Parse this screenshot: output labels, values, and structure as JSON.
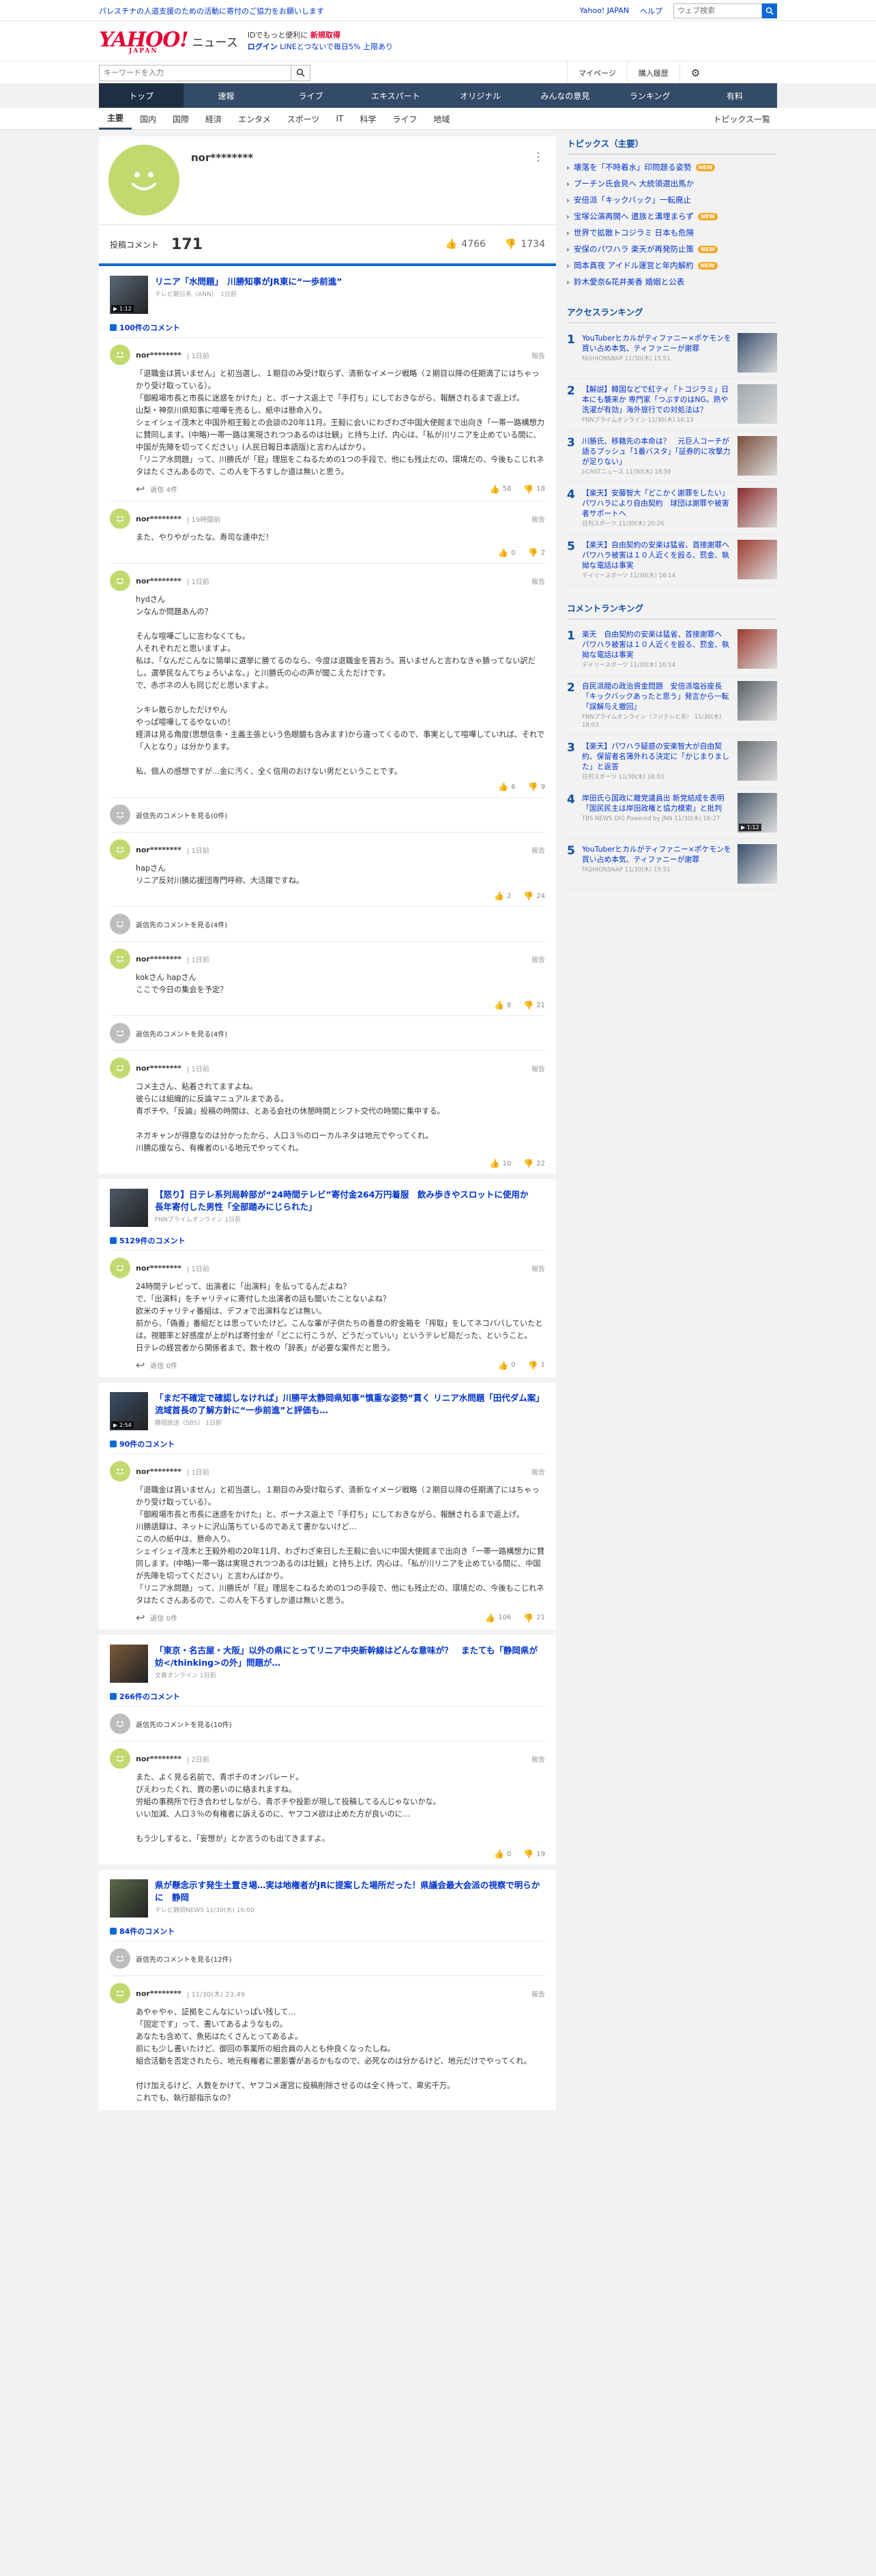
{
  "header": {
    "notice": "パレスチナの人道支援のための活動に寄付のご協力をお願いします",
    "links": [
      "Yahoo! JAPAN",
      "ヘルプ"
    ],
    "search_placeholder": "ウェブ検索",
    "logo": "YAHOO!",
    "logo_sub": "JAPAN",
    "logo_news": "ニュース",
    "promo_line1_a": "IDでもっと便利に",
    "promo_line1_b": "新規取得",
    "promo_line2_a": "ログイン",
    "promo_line2_b": "LINEとつないで毎日5% 上限あり",
    "search2_placeholder": "キーワードを入力",
    "mypage": "マイページ",
    "history": "購入履歴"
  },
  "gnav": [
    "トップ",
    "速報",
    "ライブ",
    "エキスパート",
    "オリジナル",
    "みんなの意見",
    "ランキング",
    "有料"
  ],
  "snav": [
    "主要",
    "国内",
    "国際",
    "経済",
    "エンタメ",
    "スポーツ",
    "IT",
    "科学",
    "ライフ",
    "地域"
  ],
  "snav_all": "トピックス一覧",
  "profile": {
    "name": "nor********",
    "posts_label": "投稿コメント",
    "posts": "171",
    "likes": "4766",
    "dislikes": "1734"
  },
  "articles": [
    {
      "title": "リニア「水問題」　川勝知事がJR東に“一歩前進”",
      "source": "テレビ朝日系（ANN）　1日前",
      "duration": "1:12",
      "thumb_color": "#5a6978",
      "count": "100件のコメント",
      "comments": [
        {
          "user": "nor********",
          "time": "1日前",
          "body": "「退職金は貰いません」と初当選し、１期目のみ受け取らず、清新なイメージ戦略（２期目以降の任期満了にはちゃっかり受け取っている）。\n「御殿場市長と市長に迷惑をかけた」と、ボーナス返上で「手打ち」にしておきながら、報酬されるまで返上げ。\n山梨・神奈川県知事に喧嘩を売るし、紙中は懸命入り。\nシェイシェイ茂木と中国外相王毅との会談の20年11月。王毅に会いにわざわざ中国大使館まで出向き「一帯一路構想力に賛同します。(中略)一帯一路は実現されつつあるのは壮観」と持ち上げ、内心は、「私が川リニアを止めている間に、中国が先陣を切ってください」(人民日報日本語版)と言わんばかり。\n「リニア水問題」って、川勝氏が「屁」理屈をこねるための1つの手段で、他にも残止だの、環境だの、今後もこじれネタはたくさんあるので、この人を下ろすしか道は無いと思う。",
          "reply_label": "返信",
          "reply_count": "4件",
          "up": "58",
          "down": "18"
        },
        {
          "user": "nor********",
          "time": "19時間前",
          "body": "また、やりやがったな。寿司な連中だ！",
          "reply_label": "",
          "reply_count": "",
          "up": "0",
          "down": "2"
        },
        {
          "user": "nor********",
          "time": "1日前",
          "body": "hydさん\nンなんか問題あんの？\n\nそんな喧嘩ごしに言わなくても。\n人それぞれだと思いますよ。\n私は、「なんだこんなに簡単に選挙に勝てるのなら、今度は退職金を貰おう。貰いませんと言わなきゃ勝ってない訳だし。選挙民なんてちょろいよな。」と川勝氏の心の声が聞こえただけです。\nで、赤ボネの人も同じだと思いますよ。\n\nンキレ散らかしただけやん\nやっぱ喧嘩してるやないの！\n経済は見る角度(思想信条・主義主張という色眼鏡も含みます)から違ってくるので、事実として喧嘩していれば、それで「人となり」は分かります。\n\n私、個人の感想ですが…金に汚く、全く信用のおけない男だということです。",
          "reply_label": "",
          "reply_count": "",
          "up": "6",
          "down": "9"
        },
        {
          "user": "nor********",
          "time": "1日前",
          "body": "hapさん\nリニア反対川勝応援団専門呼称、大活躍ですね。",
          "reply_label": "",
          "reply_count": "",
          "up": "2",
          "down": "24",
          "pre_link": "返信先のコメントを見る(0件)"
        },
        {
          "user": "nor********",
          "time": "1日前",
          "body": "kokさん hapさん\nここで今日の集会を予定？",
          "reply_label": "",
          "reply_count": "",
          "up": "8",
          "down": "21",
          "pre_link": "返信先のコメントを見る(4件)"
        },
        {
          "user": "nor********",
          "time": "1日前",
          "body": "コメ主さん、粘着されてますよね。\n彼らには組織的に反論マニュアルまである。\n青ボチや、「反論」投稿の時間は、とある会社の休憩時間とシフト交代の時間に集中する。\n\nネガキャンが得意なのは分かったから、人口３％のローカルネタは地元でやってくれ。\n川勝応援なら、有権者のいる地元でやってくれ。",
          "reply_label": "",
          "reply_count": "",
          "up": "10",
          "down": "22",
          "pre_link": "返信先のコメントを見る(4件)"
        }
      ]
    },
    {
      "title": "【怒り】日テレ系列局幹部が“24時間テレビ”寄付金264万円着服　飲み歩きやスロットに使用か　長年寄付した男性「全部踏みにじられた」",
      "source": "FNNプライムオンライン 1日前",
      "duration": "",
      "thumb_color": "#4d5a66",
      "count": "5129件のコメント",
      "comments": [
        {
          "user": "nor********",
          "time": "1日前",
          "body": "24時間テレビって、出演者に「出演料」を払ってるんだよね？\nで、「出演料」をチャリティに寄付した出演者の話も聞いたことないよね？\n欧米のチャリティ番組は、デフォで出演料などは無い。\n前から、「偽善」番組だとは思っていたけど。こんな輩が子供たちの善意の貯金箱を「搾取」をしてネコババしていたとは。視聴率と好感度が上がれば寄付金が「どこに行こうが、どうだっていい」というテレビ局だった、ということ。\n日テレの経営者から関係者まで、数十枚の「辞表」が必要な案件だと思う。",
          "reply_label": "返信",
          "reply_count": "0件",
          "up": "0",
          "down": "1"
        }
      ]
    },
    {
      "title": "「まだ不確定で確認しなければ」川勝平太静岡県知事“慎重な姿勢”貫く リニア水問題「田代ダム案」流域首長の了解方針に“一歩前進”と評価も…",
      "source": "静岡放送（SBS） 1日前",
      "duration": "2:54",
      "thumb_color": "#3c4f66",
      "count": "90件のコメント",
      "comments": [
        {
          "user": "nor********",
          "time": "1日前",
          "body": "「退職金は貰いません」と初当選し、１期目のみ受け取らず、清新なイメージ戦略（２期目以降の任期満了にはちゃっかり受け取っている）。\n「御殿場市長と市長に迷惑をかけた」と、ボーナス返上で「手打ち」にしておきながら、報酬されるまで返上げ。\n川勝語録は、ネットに沢山落ちているのであえて書かないけど…\nこの人の紙中は、懸命入り。\nシェイシェイ茂木と王毅外相の20年11月、わざわざ来日した王毅に会いに中国大使館まで出向き「一帯一路構想力に賛同します。(中略)一帯一路は実現されつつあるのは壮観」と持ち上げ、内心は、「私が川リニアを止めている間に、中国が先陣を切ってください」と言わんばかり。\n「リニア水問題」って、川勝氏が「屁」理屈をこねるための1つの手段で、他にも残止だの、環境だの、今後もこじれネタはたくさんあるので、この人を下ろすしか道は無いと思う。",
          "reply_label": "返信",
          "reply_count": "0件",
          "up": "106",
          "down": "21"
        }
      ]
    },
    {
      "title": "「東京・名古屋・大阪」以外の県にとってリニア中央新幹線はどんな意味が？　またても「静岡県が妨</thinking>の外」問題が…",
      "source": "文春オンライン 1日前",
      "duration": "",
      "thumb_color": "#7b5b3c",
      "count": "266件のコメント",
      "comments": [
        {
          "user": "nor********",
          "time": "2日前",
          "body": "また、よく見る名前で、青ボチのオンパレード。\nぴえわったくれ、買の悪いのに絡まれますね。\n労組の事務所で行き合わせしながら、青ボチや投影が現して投稿してるんじゃないかな。\nいい加減、人口３％の有権者に訴えるのに、ヤフコメ欲は止めた方が良いのに…\n\nもう少しすると、「妄想が」とか言うのも出てきますよ。",
          "reply_label": "",
          "reply_count": "",
          "up": "0",
          "down": "19",
          "pre_link": "返信先のコメントを見る(10件)"
        }
      ]
    },
    {
      "title": "県が懸念示す発生土置き場…実は地権者がJRに提案した場所だった！県議会最大会派の視察で明らかに　静岡",
      "source": "テレビ静岡NEWS 11/30(木) 16:00",
      "duration": "",
      "thumb_color": "#5c6b4a",
      "count": "84件のコメント",
      "comments": [
        {
          "user": "nor********",
          "time": "11/30(木) 23:49",
          "body": "あやゃやゃ、証拠をこんなにいっぱい残して…\n「固定です」って、書いてあるようなもの。\nあなたも含めて、魚拓はたくさんとってあるよ。\n前にも少し書いたけど、御回の事業所の組合員の人とも仲良くなったしね。\n組合活動を否定されたら、地元有権者に悪影響があるかもなので、必死なのは分かるけど、地元だけでやってくれ。\n\n付け加えるけど、人数をかけて、ヤフコメ運営に投稿削除させるのは全く持って、卑劣千万。\nこれでも、執行部指示なの？",
          "reply_label": "",
          "reply_count": "",
          "up": "",
          "down": "",
          "pre_link": "返信先のコメントを見る(12件)"
        }
      ]
    }
  ],
  "sidebar": {
    "topics_title": "トピックス（主要）",
    "topics": [
      {
        "t": "壊落を「不時着水」印問題る姿勢",
        "new": true
      },
      {
        "t": "プーチン氏会見へ 大統領選出馬か",
        "new": false
      },
      {
        "t": "安倍派「キックバック」一転廃止",
        "new": false
      },
      {
        "t": "宝塚公演再開へ 遺族と溝埋まらず",
        "new": true
      },
      {
        "t": "世界で拡散トコジラミ 日本も危険",
        "new": false
      },
      {
        "t": "安保のパワハラ 楽天が再発防止策",
        "new": true
      },
      {
        "t": "岡本真夜 アイドル運営と年内解約",
        "new": true
      },
      {
        "t": "鈴木愛奈&花井美香 婚姻と公表",
        "new": false
      }
    ],
    "new_label": "NEW",
    "access_title": "アクセスランキング",
    "access": [
      {
        "n": "1",
        "t": "YouTuberヒカルがティファニー×ポケモンを買い占め本気、ティファニーが謝罪",
        "s": "FASHIONSNAP 11/30(木) 15:51",
        "c": "#3a4e6c",
        "dur": ""
      },
      {
        "n": "2",
        "t": "【解説】韓国などで紅ティ「トコジラミ」日本にも襲来か 専門家「つぶすのはNG。熱や洗濯が有効」海外旅行での対処法は？",
        "s": "FNNプライムオンライン 11/30(木) 16:13",
        "c": "#a0a7ad",
        "dur": ""
      },
      {
        "n": "3",
        "t": "川勝氏、移籍先の本命は？　元巨人コーチが語るプッシュ「1番バスタ」「証券的に攻撃力が足りない」",
        "s": "J-CASTニュース 11/30(木) 18:50",
        "c": "#7a4e3a",
        "dur": ""
      },
      {
        "n": "4",
        "t": "【楽天】安藤智大「どこかく謝罪をしたい」パワハラにより自由契約　球団は謝罪や被害者サポートへ",
        "s": "日刊スポーツ 11/30(木) 20:26",
        "c": "#8b2d2d",
        "dur": ""
      },
      {
        "n": "5",
        "t": "【楽天】自由契約の安楽は猛省、首接謝罪へ　パワハラ被害は１０人近くを殴る、罰金、執拗な電話は事実",
        "s": "デイリースポーツ 11/30(木) 16:14",
        "c": "#9c3b2e",
        "dur": ""
      }
    ],
    "comment_title": "コメントランキング",
    "comment_rank": [
      {
        "n": "1",
        "t": "楽天　自由契約の安楽は猛省、首接謝罪へ　パワハラ被害は１０人近くを殴る、罰金、執拗な電話は事実",
        "s": "デイリースポーツ 11/30(木) 16:14",
        "c": "#9c3b2e",
        "dur": ""
      },
      {
        "n": "2",
        "t": "自民派閥の政治資金問題　安倍派塩谷座長「キックバックあったと思う」発言から一転「誤解与え撤回」",
        "s": "FNNプライムオンライン（フジテレビ系） 11/30(木) 18:03",
        "c": "#5a5f66",
        "dur": ""
      },
      {
        "n": "3",
        "t": "【楽天】パワハラ疑惑の安楽智大が自由契約、保留者名簿外れる決定に「かじまりました」と返答",
        "s": "日刊スポーツ 11/30(木) 16:03",
        "c": "#6b6f75",
        "dur": ""
      },
      {
        "n": "4",
        "t": "岸田氏ら国政に離党議員出 新党結成を表明「国民民主は岸田政権と協力模索」と批判",
        "s": "TBS NEWS DIG Powered by JNN 11/30(木) 16:27",
        "c": "#4a5a6c",
        "dur": "1:12"
      },
      {
        "n": "5",
        "t": "YouTuberヒカルがティファニー×ポケモンを買い占め本気、ティファニーが謝罪",
        "s": "FASHIONSNAP 11/30(木) 15:51",
        "c": "#3a4e6c",
        "dur": ""
      }
    ]
  }
}
